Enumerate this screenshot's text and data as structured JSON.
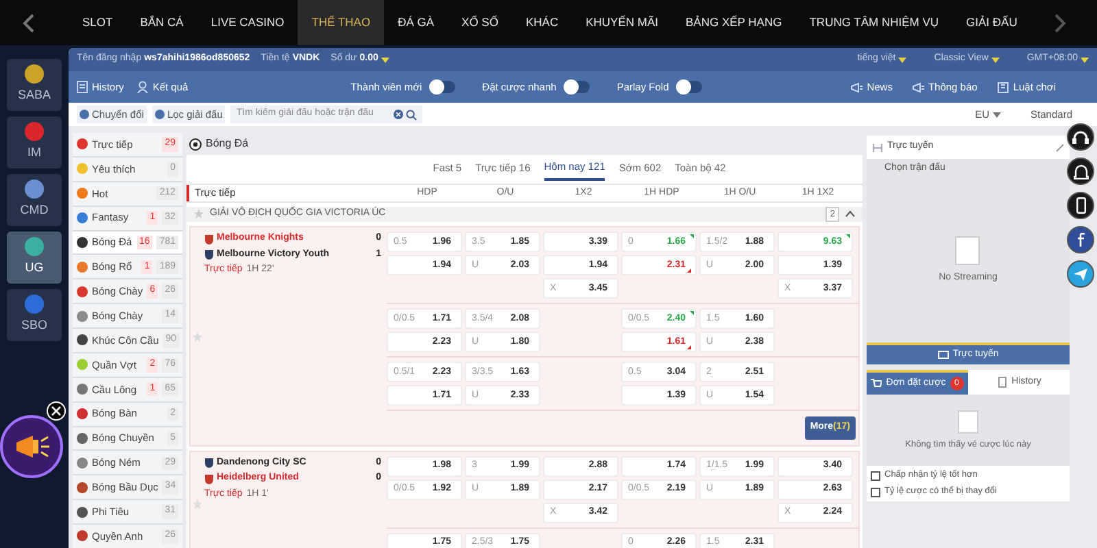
{
  "top_nav": {
    "items": [
      {
        "label": "SLOT",
        "selected": false
      },
      {
        "label": "BẮN CÁ",
        "selected": false
      },
      {
        "label": "LIVE CASINO",
        "selected": false
      },
      {
        "label": "THỂ THAO",
        "selected": true
      },
      {
        "label": "ĐÁ GÀ",
        "selected": false
      },
      {
        "label": "XỔ SỐ",
        "selected": false
      },
      {
        "label": "KHÁC",
        "selected": false
      },
      {
        "label": "KHUYẾN MÃI",
        "selected": false
      },
      {
        "label": "BẢNG XẾP HẠNG",
        "selected": false
      },
      {
        "label": "TRUNG TÂM NHIỆM VỤ",
        "selected": false
      },
      {
        "label": "GIẢI ĐẤU",
        "selected": false
      }
    ]
  },
  "providers": [
    {
      "label": "SABA",
      "selected": false,
      "color": "#c9a227"
    },
    {
      "label": "IM",
      "selected": false,
      "color": "#d9262c"
    },
    {
      "label": "CMD",
      "selected": false,
      "color": "#6a8fd0"
    },
    {
      "label": "UG",
      "selected": true,
      "color": "#3bb0a0"
    },
    {
      "label": "SBO",
      "selected": false,
      "color": "#2d6bd8"
    }
  ],
  "account_bar": {
    "username_label": "Tên đăng nhập",
    "username": "ws7ahihi1986od850652",
    "currency_label": "Tiền tệ",
    "currency": "VNDK",
    "balance_label": "Số dư",
    "balance": "0.00",
    "language": "tiếng việt",
    "view": "Classic View",
    "timezone": "GMT+08:00"
  },
  "toolbar": {
    "links": [
      "History",
      "Kết quả"
    ],
    "toggles": [
      {
        "label": "Thành viên mới",
        "on": false
      },
      {
        "label": "Đặt cược nhanh",
        "on": false
      },
      {
        "label": "Parlay Fold",
        "on": false
      }
    ],
    "right_links": [
      "News",
      "Thông báo",
      "Luật chơi"
    ]
  },
  "filter_bar": {
    "buttons": [
      "Chuyển đổi",
      "Lọc giải đấu"
    ],
    "search": {
      "placeholder": "Tìm kiếm giải đấu hoặc trận đấu"
    },
    "odds_type": "EU",
    "view_mode": "Standard"
  },
  "sports": [
    {
      "label": "Trực tiếp",
      "live": "29",
      "selected": false,
      "color": "#e0342f"
    },
    {
      "label": "Yêu thích",
      "total": "0",
      "selected": false,
      "color": "#f2c12e"
    },
    {
      "label": "Hot",
      "total": "212",
      "selected": false,
      "color": "#f07a1a"
    },
    {
      "label": "Fantasy",
      "live": "1",
      "total": "32",
      "selected": false,
      "color": "#3a7bd5"
    },
    {
      "label": "Bóng Đá",
      "live": "16",
      "total": "781",
      "selected": true,
      "color": "#333333"
    },
    {
      "label": "Bóng Rổ",
      "live": "1",
      "total": "189",
      "selected": false,
      "color": "#e8792b"
    },
    {
      "label": "Bóng Chày",
      "live": "6",
      "total": "26",
      "selected": false,
      "color": "#d93a2f"
    },
    {
      "label": "Bóng Chày",
      "total": "14",
      "selected": false,
      "color": "#8a8a8a"
    },
    {
      "label": "Khúc Côn Cầu",
      "total": "90",
      "selected": false,
      "color": "#444444"
    },
    {
      "label": "Quần Vợt",
      "live": "2",
      "total": "76",
      "selected": false,
      "color": "#9acd32"
    },
    {
      "label": "Cầu Lông",
      "live": "1",
      "total": "65",
      "selected": false,
      "color": "#777777"
    },
    {
      "label": "Bóng Bàn",
      "total": "2",
      "selected": false,
      "color": "#d03030"
    },
    {
      "label": "Bóng Chuyền",
      "total": "5",
      "selected": false,
      "color": "#666666"
    },
    {
      "label": "Bóng Ném",
      "total": "29",
      "selected": false,
      "color": "#888888"
    },
    {
      "label": "Bóng Bầu Dục",
      "total": "34",
      "selected": false,
      "color": "#b5452b"
    },
    {
      "label": "Phi Tiêu",
      "total": "31",
      "selected": false,
      "color": "#555555"
    },
    {
      "label": "Quyền Anh",
      "total": "26",
      "selected": false,
      "color": "#c0392b"
    }
  ],
  "section_title": "Bóng Đá",
  "period_tabs": [
    {
      "label": "Fast 5",
      "selected": false
    },
    {
      "label": "Trực tiếp 16",
      "selected": false
    },
    {
      "label": "Hôm nay 121",
      "selected": true
    },
    {
      "label": "Sớm 602",
      "selected": false
    },
    {
      "label": "Toàn bộ 42",
      "selected": false
    }
  ],
  "table": {
    "title": "Trực tiếp",
    "columns": [
      "HDP",
      "O/U",
      "1X2",
      "1H HDP",
      "1H O/U",
      "1H 1X2"
    ],
    "leagues": [
      {
        "name": "GIẢI VÔ ĐỊCH QUỐC GIA VICTORIA ÚC",
        "match_count": "2",
        "expanded": true,
        "matches": [
          {
            "teams": [
              {
                "name": "Melbourne Knights",
                "score": "0",
                "favorite": true
              },
              {
                "name": "Melbourne Victory Youth",
                "score": "1",
                "favorite": false
              }
            ],
            "status": "Trực tiếp",
            "clock": "1H 22'",
            "odds_groups": [
              [
                [
                  {
                    "kind": "odds",
                    "line": "0.5",
                    "odds": "1.96"
                  },
                  {
                    "kind": "odds",
                    "line": "3.5",
                    "odds": "1.85"
                  },
                  {
                    "kind": "odds",
                    "odds": "3.39"
                  },
                  {
                    "kind": "odds",
                    "line": "0",
                    "odds": "1.66",
                    "rising": true
                  },
                  {
                    "kind": "odds",
                    "line": "1.5/2",
                    "odds": "1.88"
                  },
                  {
                    "kind": "odds",
                    "odds": "9.63",
                    "rising": true
                  }
                ],
                [
                  {
                    "kind": "odds",
                    "odds": "1.94"
                  },
                  {
                    "kind": "odds",
                    "line": "U",
                    "odds": "2.03"
                  },
                  {
                    "kind": "odds",
                    "odds": "1.94"
                  },
                  {
                    "kind": "odds",
                    "odds": "2.31",
                    "rising": false
                  },
                  {
                    "kind": "odds",
                    "line": "U",
                    "odds": "2.00"
                  },
                  {
                    "kind": "odds",
                    "odds": "1.39"
                  }
                ],
                [
                  {
                    "kind": "empty"
                  },
                  {
                    "kind": "empty"
                  },
                  {
                    "kind": "odds",
                    "line": "X",
                    "odds": "3.45"
                  },
                  {
                    "kind": "empty"
                  },
                  {
                    "kind": "empty"
                  },
                  {
                    "kind": "odds",
                    "line": "X",
                    "odds": "3.37"
                  }
                ]
              ],
              [
                [
                  {
                    "kind": "odds",
                    "line": "0/0.5",
                    "odds": "1.71"
                  },
                  {
                    "kind": "odds",
                    "line": "3.5/4",
                    "odds": "2.08"
                  },
                  {
                    "kind": "empty"
                  },
                  {
                    "kind": "odds",
                    "line": "0/0.5",
                    "odds": "2.40",
                    "rising": true
                  },
                  {
                    "kind": "odds",
                    "line": "1.5",
                    "odds": "1.60"
                  },
                  {
                    "kind": "empty"
                  }
                ],
                [
                  {
                    "kind": "odds",
                    "odds": "2.23"
                  },
                  {
                    "kind": "odds",
                    "line": "U",
                    "odds": "1.80"
                  },
                  {
                    "kind": "empty"
                  },
                  {
                    "kind": "odds",
                    "odds": "1.61",
                    "rising": false
                  },
                  {
                    "kind": "odds",
                    "line": "U",
                    "odds": "2.38"
                  },
                  {
                    "kind": "empty"
                  }
                ]
              ],
              [
                [
                  {
                    "kind": "odds",
                    "line": "0.5/1",
                    "odds": "2.23"
                  },
                  {
                    "kind": "odds",
                    "line": "3/3.5",
                    "odds": "1.63"
                  },
                  {
                    "kind": "empty"
                  },
                  {
                    "kind": "odds",
                    "line": "0.5",
                    "odds": "3.04"
                  },
                  {
                    "kind": "odds",
                    "line": "2",
                    "odds": "2.51"
                  },
                  {
                    "kind": "empty"
                  }
                ],
                [
                  {
                    "kind": "odds",
                    "odds": "1.71"
                  },
                  {
                    "kind": "odds",
                    "line": "U",
                    "odds": "2.33"
                  },
                  {
                    "kind": "empty"
                  },
                  {
                    "kind": "odds",
                    "odds": "1.39"
                  },
                  {
                    "kind": "odds",
                    "line": "U",
                    "odds": "1.54"
                  },
                  {
                    "kind": "empty"
                  }
                ]
              ]
            ],
            "more": {
              "label": "More",
              "count": "(17)"
            }
          },
          {
            "teams": [
              {
                "name": "Dandenong City SC",
                "score": "0",
                "favorite": false
              },
              {
                "name": "Heidelberg United",
                "score": "0",
                "favorite": true
              }
            ],
            "status": "Trực tiếp",
            "clock": "1H 1'",
            "odds_groups": [
              [
                [
                  {
                    "kind": "odds",
                    "odds": "1.98"
                  },
                  {
                    "kind": "odds",
                    "line": "3",
                    "odds": "1.99"
                  },
                  {
                    "kind": "odds",
                    "odds": "2.88"
                  },
                  {
                    "kind": "odds",
                    "odds": "1.74"
                  },
                  {
                    "kind": "odds",
                    "line": "1/1.5",
                    "odds": "1.99"
                  },
                  {
                    "kind": "odds",
                    "odds": "3.40"
                  }
                ],
                [
                  {
                    "kind": "odds",
                    "line": "0/0.5",
                    "odds": "1.92"
                  },
                  {
                    "kind": "odds",
                    "line": "U",
                    "odds": "1.89"
                  },
                  {
                    "kind": "odds",
                    "odds": "2.17"
                  },
                  {
                    "kind": "odds",
                    "line": "0/0.5",
                    "odds": "2.19"
                  },
                  {
                    "kind": "odds",
                    "line": "U",
                    "odds": "1.89"
                  },
                  {
                    "kind": "odds",
                    "odds": "2.63"
                  }
                ],
                [
                  {
                    "kind": "empty"
                  },
                  {
                    "kind": "empty"
                  },
                  {
                    "kind": "odds",
                    "line": "X",
                    "odds": "3.42"
                  },
                  {
                    "kind": "empty"
                  },
                  {
                    "kind": "empty"
                  },
                  {
                    "kind": "odds",
                    "line": "X",
                    "odds": "2.24"
                  }
                ]
              ],
              [
                [
                  {
                    "kind": "odds",
                    "odds": "1.75"
                  },
                  {
                    "kind": "odds",
                    "line": "2.5/3",
                    "odds": "1.75"
                  },
                  {
                    "kind": "empty"
                  },
                  {
                    "kind": "odds",
                    "line": "0",
                    "odds": "2.26"
                  },
                  {
                    "kind": "odds",
                    "line": "1.5",
                    "odds": "2.31"
                  },
                  {
                    "kind": "empty"
                  }
                ]
              ]
            ]
          }
        ]
      }
    ]
  },
  "stream": {
    "title": "Trực tuyến",
    "prompt": "Chọn trận đấu",
    "empty": "No Streaming",
    "button": "Trực tuyến"
  },
  "betslip": {
    "tabs": [
      {
        "label": "Đơn đặt cược",
        "badge": "0",
        "selected": true
      },
      {
        "label": "History",
        "selected": false
      }
    ],
    "empty": "Không tìm thấy vé cược lúc này",
    "options": [
      {
        "label": "Chấp nhận tỷ lệ tốt hơn",
        "checked": false
      },
      {
        "label": "Tỷ lệ cược có thể bị thay đổi",
        "checked": false
      }
    ]
  }
}
